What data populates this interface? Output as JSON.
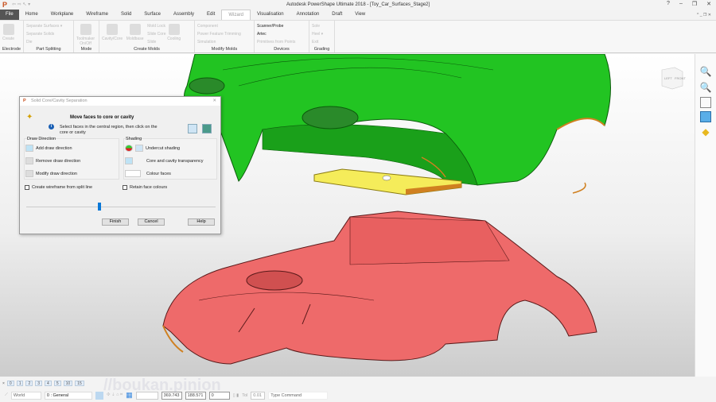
{
  "window": {
    "title": "Autodesk PowerShape Ultimate 2018 - [Toy_Car_Surfaces_Stage2]",
    "logo": "P",
    "qat": "⇦ ⇨ ↖ ▾",
    "controls": [
      "?",
      "–",
      "❐",
      "✕"
    ],
    "sub_controls": "^ _ ❐ ✕"
  },
  "tabs": [
    "File",
    "Home",
    "Workplane",
    "Wireframe",
    "Solid",
    "Surface",
    "Assembly",
    "Edit",
    "Wizard",
    "Visualisation",
    "Annotation",
    "Draft",
    "View"
  ],
  "active_tab": "Wizard",
  "ribbon": {
    "electrode": {
      "label": "Electrode",
      "items": [
        "Create"
      ]
    },
    "part_splitting": {
      "label": "Part Splitting",
      "items": [
        "Separate Surfaces ▾",
        "Separate Solids",
        "Die"
      ]
    },
    "mode": {
      "label": "Mode",
      "items": [
        "Toolmaker On/Off"
      ]
    },
    "create_molds": {
      "label": "Create Molds",
      "big": [
        "Cavity/Core",
        "Moldbase"
      ],
      "small": [
        "Mold Lock",
        "Slide Core",
        "Slide"
      ],
      "extra": "Cooling"
    },
    "modify_molds": {
      "label": "Modify Molds",
      "items": [
        "Component",
        "Power Feature Trimming",
        "Simulation"
      ]
    },
    "devices": {
      "label": "Devices",
      "items": [
        "Scanner/Probe",
        "Artec",
        "Primitives from Points"
      ]
    },
    "grading": {
      "label": "Grading",
      "items": [
        "Sole",
        "Heel ▾",
        "Exit"
      ]
    }
  },
  "dialog": {
    "title": "Solid Core/Cavity Separation",
    "heading": "Move faces to core or cavity",
    "info": "Select faces in the central region, then click on the core or cavity",
    "draw_direction": {
      "label": "Draw Direction",
      "items": [
        "Add draw direction",
        "Remove draw direction",
        "Modify draw direction"
      ]
    },
    "shading": {
      "label": "Shading",
      "items": [
        "Undercut shading",
        "Core and cavity transparency",
        "Colour faces"
      ]
    },
    "checkboxes": [
      "Create wireframe from split line",
      "Retain face colours"
    ],
    "slider_value": 0.42,
    "buttons": [
      "Finish",
      "Cancel",
      "Help"
    ]
  },
  "viewcube": {
    "left": "LEFT",
    "front": "FRONT"
  },
  "status": {
    "pages": [
      "0",
      "1",
      "2",
      "3",
      "4",
      "5",
      "10",
      "15"
    ],
    "workplane": "World",
    "level": "0 : General",
    "coords": [
      "369.743",
      "188.571",
      "0"
    ],
    "tol_label": "Tol",
    "tol": "0.01",
    "command": "Type Command"
  },
  "watermark": "//boukan.pinion",
  "colors": {
    "cavity": "#22cc22",
    "core": "#ee6a6a",
    "split": "#f0e040",
    "edge": "#d08020"
  }
}
